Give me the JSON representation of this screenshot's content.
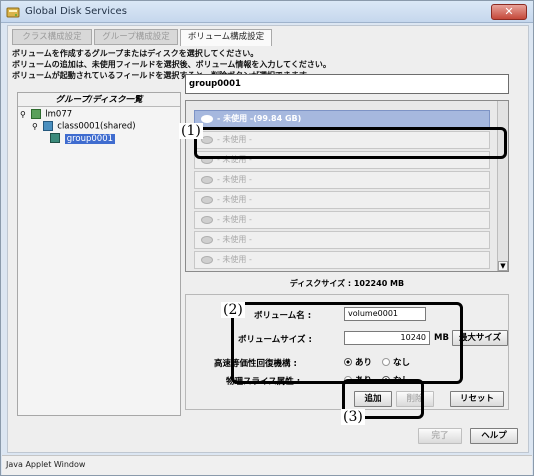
{
  "window": {
    "title": "Global Disk Services",
    "close_glyph": "✕"
  },
  "tabs": [
    {
      "label": "クラス構成設定",
      "active": false
    },
    {
      "label": "グループ構成設定",
      "active": false
    },
    {
      "label": "ボリューム構成設定",
      "active": true
    }
  ],
  "instructions": [
    "ボリュームを作成するグループまたはディスクを選択してください。",
    "ボリュームの追加は、未使用フィールドを選択後、ボリューム情報を入力してください。",
    "ボリュームが起動されているフィールドを選択すると、削除ボタンが選択できます。"
  ],
  "tree": {
    "header": "グループ/ディスク一覧",
    "items": [
      {
        "label": "lm077",
        "icon": "host-icon"
      },
      {
        "label": "class0001(shared)",
        "icon": "class-icon"
      },
      {
        "label": "group0001",
        "icon": "group-icon",
        "selected": true
      }
    ]
  },
  "group_field": "group0001",
  "volume_list": {
    "rows": [
      {
        "label": "- 未使用 -(99.84 GB)",
        "selected": true
      },
      {
        "label": "- 未使用 -",
        "selected": false
      },
      {
        "label": "- 未使用 -",
        "selected": false
      },
      {
        "label": "- 未使用 -",
        "selected": false
      },
      {
        "label": "- 未使用 -",
        "selected": false
      },
      {
        "label": "- 未使用 -",
        "selected": false
      },
      {
        "label": "- 未使用 -",
        "selected": false
      },
      {
        "label": "- 未使用 -",
        "selected": false
      }
    ],
    "scroll_down": "▼"
  },
  "disk_size": "ディスクサイズ : 102240 MB",
  "form": {
    "volume_name_label": "ボリューム名 :",
    "volume_name_value": "volume0001",
    "volume_size_label": "ボリュームサイズ :",
    "volume_size_value": "10240",
    "unit": "MB",
    "max_size_button": "最大サイズ",
    "jrm_label": "高速等価性回復機構 :",
    "physical_slice_label": "物理スライス属性 :",
    "opt_yes": "あり",
    "opt_no": "なし",
    "jrm_value": "あり",
    "physical_slice_value": "なし"
  },
  "buttons": {
    "add": "追加",
    "delete": "削除",
    "reset": "リセット",
    "done": "完了",
    "help": "ヘルプ"
  },
  "callouts": {
    "c1": "(1)",
    "c2": "(2)",
    "c3": "(3)"
  },
  "status": "Java Applet Window"
}
